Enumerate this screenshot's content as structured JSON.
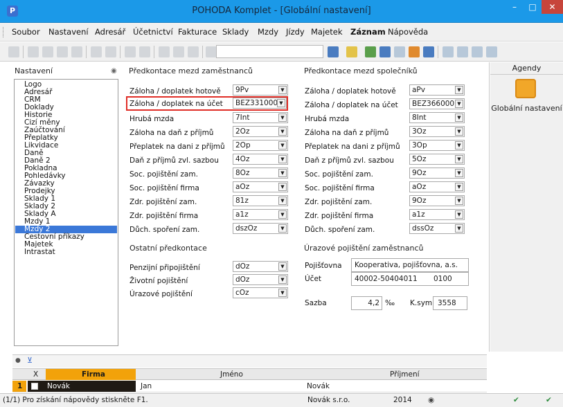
{
  "window": {
    "title": "POHODA Komplet - [Globální nastavení]",
    "min_glyph": "–",
    "max_glyph": "□",
    "close_glyph": "✕"
  },
  "menu": [
    "Soubor",
    "Nastavení",
    "Adresář",
    "Účetnictví",
    "Fakturace",
    "Sklady",
    "Mzdy",
    "Jízdy",
    "Majetek",
    "Záznam",
    "Nápověda"
  ],
  "settings": {
    "label": "Nastavení",
    "items": [
      "Logo",
      "Adresář",
      "CRM",
      "Doklady",
      "Historie",
      "Cizí měny",
      "Zaúčtování",
      "Přeplatky",
      "Likvidace",
      "Daně",
      "Daně 2",
      "Pokladna",
      "Pohledávky",
      "Závazky",
      "Prodejky",
      "Sklady 1",
      "Sklady 2",
      "Sklady A",
      "Mzdy 1",
      "Mzdy 2",
      "Cestovní příkazy",
      "Majetek",
      "Intrastat"
    ],
    "selected": "Mzdy 2"
  },
  "employees": {
    "title": "Předkontace mezd zaměstnanců",
    "rows": [
      {
        "label": "Záloha / doplatek hotově",
        "value": "9Pv"
      },
      {
        "label": "Záloha / doplatek na účet",
        "value": "BEZ331000"
      },
      {
        "label": "Hrubá mzda",
        "value": "7Int"
      },
      {
        "label": "Záloha na daň z příjmů",
        "value": "2Oz"
      },
      {
        "label": "Přeplatek na dani z příjmů",
        "value": "2Op"
      },
      {
        "label": "Daň z příjmů zvl. sazbou",
        "value": "4Oz"
      },
      {
        "label": "Soc. pojištění zam.",
        "value": "8Oz"
      },
      {
        "label": "Soc. pojištění firma",
        "value": "aOz"
      },
      {
        "label": "Zdr. pojištění zam.",
        "value": "81z"
      },
      {
        "label": "Zdr. pojištění firma",
        "value": "a1z"
      },
      {
        "label": "Důch. spoření zam.",
        "value": "dszOz"
      }
    ]
  },
  "partners": {
    "title": "Předkontace mezd společníků",
    "rows": [
      {
        "label": "Záloha / doplatek hotově",
        "value": "aPv"
      },
      {
        "label": "Záloha / doplatek na účet",
        "value": "BEZ366000"
      },
      {
        "label": "Hrubá mzda",
        "value": "8Int"
      },
      {
        "label": "Záloha na daň z příjmů",
        "value": "3Oz"
      },
      {
        "label": "Přeplatek na dani z příjmů",
        "value": "3Op"
      },
      {
        "label": "Daň z příjmů zvl. sazbou",
        "value": "5Oz"
      },
      {
        "label": "Soc. pojištění zam.",
        "value": "9Oz"
      },
      {
        "label": "Soc. pojištění firma",
        "value": "aOz"
      },
      {
        "label": "Zdr. pojištění zam.",
        "value": "9Oz"
      },
      {
        "label": "Zdr. pojištění firma",
        "value": "a1z"
      },
      {
        "label": "Důch. spoření zam.",
        "value": "dssOz"
      }
    ]
  },
  "other": {
    "title": "Ostatní předkontace",
    "rows": [
      {
        "label": "Penzijní připojištění",
        "value": "dOz"
      },
      {
        "label": "Životní pojištění",
        "value": "dOz"
      },
      {
        "label": "Úrazové pojištění",
        "value": "cOz"
      }
    ]
  },
  "accident": {
    "title": "Úrazové pojištění zaměstnanců",
    "insurer_label": "Pojišťovna",
    "insurer_value": "Kooperativa, pojišťovna, a.s.",
    "account_label": "Účet",
    "account_value": "40002-50404011",
    "bank_code": "0100",
    "rate_label": "Sazba",
    "rate_value": "4,2",
    "rate_unit": "‰",
    "ksym_label": "K.sym.",
    "ksym_value": "3558"
  },
  "agendy": {
    "header": "Agendy",
    "item": "Globální nastavení"
  },
  "grid": {
    "headers": {
      "x": "X",
      "firma": "Firma",
      "jmeno": "Jméno",
      "prijmeni": "Příjmení"
    },
    "row": {
      "num": "1",
      "firma": "Novák",
      "jmeno": "Jan",
      "prijmeni": "Novák"
    }
  },
  "status": {
    "help": "(1/1) Pro získání nápovědy stiskněte F1.",
    "company": "Novák s.r.o.",
    "year": "2014"
  },
  "colors": {
    "titlebar": "#1b99e8",
    "selection": "#3b78d8",
    "highlight_border": "#e02d26",
    "grid_header_accent": "#f2a20a",
    "grid_row_accent": "#1f1a14"
  }
}
